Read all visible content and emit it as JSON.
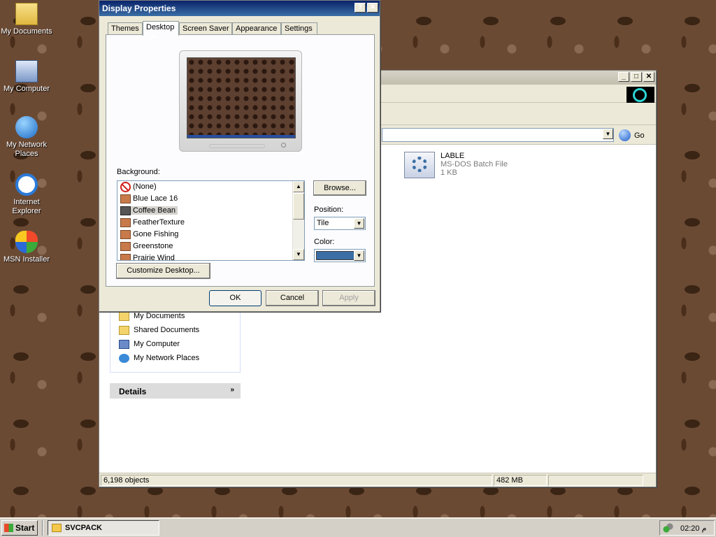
{
  "desktop": {
    "icons": [
      {
        "label": "My Documents",
        "icon": "my-documents-icon"
      },
      {
        "label": "My Computer",
        "icon": "my-computer-icon"
      },
      {
        "label": "My Network Places",
        "icon": "network-places-icon"
      },
      {
        "label": "Internet Explorer",
        "icon": "internet-explorer-icon"
      },
      {
        "label": "MSN Installer",
        "icon": "msn-butterfly-icon"
      }
    ]
  },
  "dialog": {
    "title": "Display Properties",
    "help_btn": "?",
    "close_btn": "✕",
    "tabs": [
      "Themes",
      "Desktop",
      "Screen Saver",
      "Appearance",
      "Settings"
    ],
    "active_tab": "Desktop",
    "background_label": "Background:",
    "backgrounds": [
      "(None)",
      "Blue Lace 16",
      "Coffee Bean",
      "FeatherTexture",
      "Gone Fishing",
      "Greenstone",
      "Prairie Wind"
    ],
    "selected_background": "Coffee Bean",
    "browse": "Browse...",
    "position_label": "Position:",
    "position_value": "Tile",
    "color_label": "Color:",
    "color_value": "#3a6ea5",
    "customize": "Customize Desktop...",
    "ok": "OK",
    "cancel": "Cancel",
    "apply": "Apply"
  },
  "explorer": {
    "go": "Go",
    "file": {
      "name": "LABLE",
      "type": "MS-DOS Batch File",
      "size": "1 KB"
    },
    "other_places": [
      "My Documents",
      "Shared Documents",
      "My Computer",
      "My Network Places"
    ],
    "details": "Details",
    "status_objects": "6,198 objects",
    "status_size": "482 MB"
  },
  "taskbar": {
    "start": "Start",
    "task": "SVCPACK",
    "clock": "02:20 م"
  }
}
